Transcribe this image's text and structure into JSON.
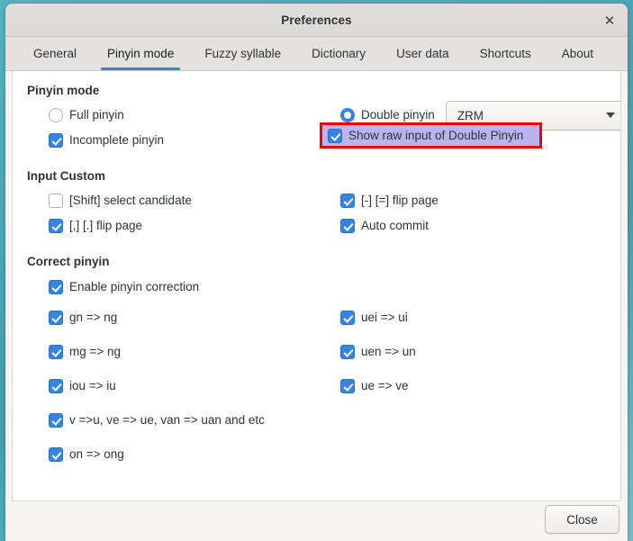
{
  "window": {
    "title": "Preferences",
    "close_icon": "close-icon",
    "close_glyph": "✕"
  },
  "tabs": [
    {
      "label": "General",
      "active": false
    },
    {
      "label": "Pinyin mode",
      "active": true
    },
    {
      "label": "Fuzzy syllable",
      "active": false
    },
    {
      "label": "Dictionary",
      "active": false
    },
    {
      "label": "User data",
      "active": false
    },
    {
      "label": "Shortcuts",
      "active": false
    },
    {
      "label": "About",
      "active": false
    }
  ],
  "sections": {
    "pinyin_mode": {
      "title": "Pinyin mode",
      "full_pinyin": {
        "label": "Full pinyin",
        "checked": false,
        "control": "radio"
      },
      "double_pinyin": {
        "label": "Double pinyin",
        "checked": true,
        "control": "radio"
      },
      "incomplete_pinyin": {
        "label": "Incomplete pinyin",
        "checked": true,
        "control": "checkbox"
      },
      "show_raw_input": {
        "label": "Show raw input of Double Pinyin",
        "checked": true,
        "control": "checkbox",
        "highlighted": true
      },
      "scheme_select": {
        "value": "ZRM",
        "icon": "chevron-down-icon"
      }
    },
    "input_custom": {
      "title": "Input Custom",
      "items_left": [
        {
          "label": "[Shift] select candidate",
          "checked": false
        },
        {
          "label": "[,] [.] flip page",
          "checked": true
        }
      ],
      "items_right": [
        {
          "label": "[-] [=] flip page",
          "checked": true
        },
        {
          "label": "Auto commit",
          "checked": true
        }
      ]
    },
    "correct_pinyin": {
      "title": "Correct pinyin",
      "enable": {
        "label": "Enable pinyin correction",
        "checked": true
      },
      "items_left": [
        {
          "label": "gn => ng",
          "checked": true
        },
        {
          "label": "mg => ng",
          "checked": true
        },
        {
          "label": "iou => iu",
          "checked": true
        },
        {
          "label": "v =>u, ve => ue, van => uan and etc",
          "checked": true
        },
        {
          "label": "on => ong",
          "checked": true
        }
      ],
      "items_right": [
        {
          "label": "uei => ui",
          "checked": true
        },
        {
          "label": "uen => un",
          "checked": true
        },
        {
          "label": "ue => ve",
          "checked": true
        }
      ]
    }
  },
  "footer": {
    "close_label": "Close"
  },
  "colors": {
    "accent": "#3584e4",
    "highlight_border": "#f20000",
    "highlight_fill": "#b9b4ef",
    "desktop_background": "#4aa7b5",
    "window_background": "#f6f5f4"
  }
}
